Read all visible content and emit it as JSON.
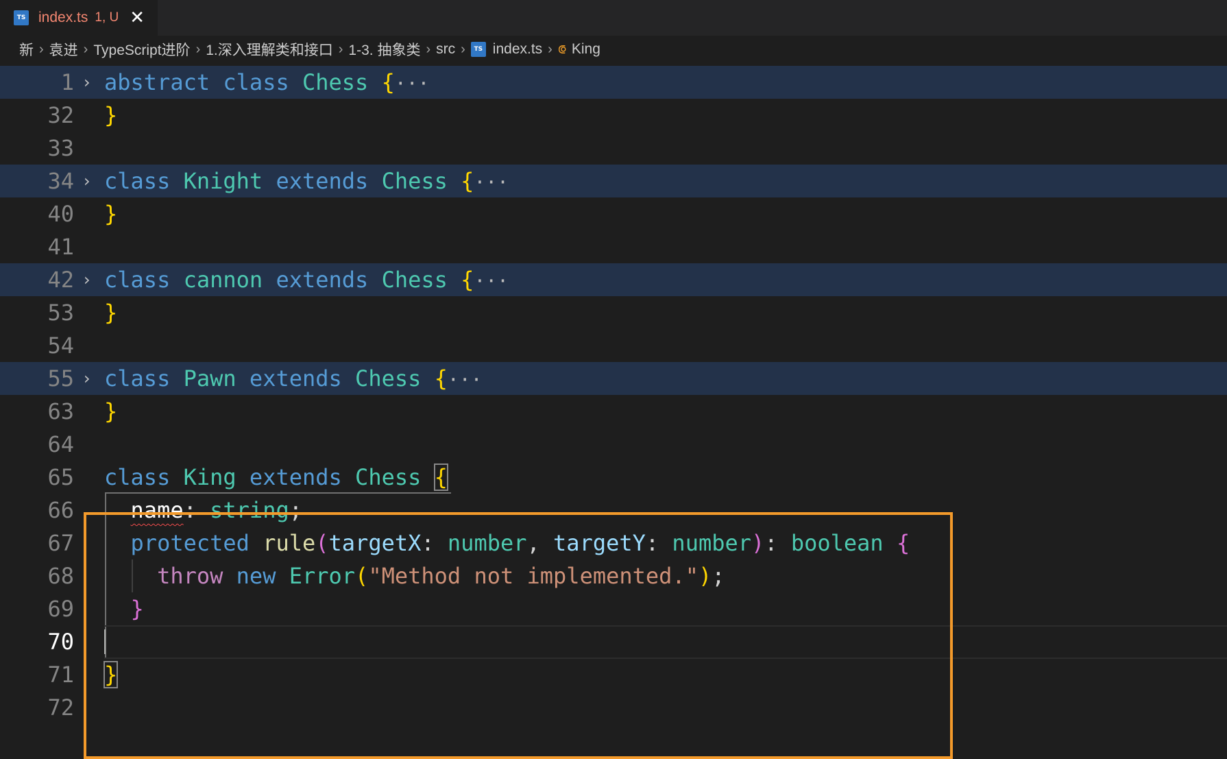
{
  "tab": {
    "icon": "TS",
    "title": "index.ts",
    "status": "1, U",
    "close": "✕"
  },
  "breadcrumb": {
    "items": [
      "新",
      "袁进",
      "TypeScript进阶",
      "1.深入理解类和接口",
      "1-3. 抽象类",
      "src"
    ],
    "file_icon": "TS",
    "file": "index.ts",
    "symbol": "King"
  },
  "editor": {
    "line_numbers": [
      "1",
      "32",
      "33",
      "34",
      "40",
      "41",
      "42",
      "53",
      "54",
      "55",
      "63",
      "64",
      "65",
      "66",
      "67",
      "68",
      "69",
      "70",
      "71",
      "72"
    ],
    "lines": {
      "l1": {
        "kw": "abstract",
        "kw_class": "class",
        "name": "Chess",
        "brace": "{",
        "dots": "···"
      },
      "l32": {
        "brace": "}"
      },
      "l34": {
        "kw": "class",
        "name": "Knight",
        "ext": "extends",
        "base": "Chess",
        "brace": "{",
        "dots": "···"
      },
      "l40": {
        "brace": "}"
      },
      "l42": {
        "kw": "class",
        "name": "cannon",
        "ext": "extends",
        "base": "Chess",
        "brace": "{",
        "dots": "···"
      },
      "l53": {
        "brace": "}"
      },
      "l55": {
        "kw": "class",
        "name": "Pawn",
        "ext": "extends",
        "base": "Chess",
        "brace": "{",
        "dots": "···"
      },
      "l63": {
        "brace": "}"
      },
      "l65": {
        "kw": "class",
        "name": "King",
        "ext": "extends",
        "base": "Chess",
        "brace": "{"
      },
      "l66": {
        "prop": "name",
        "colon": ": ",
        "type": "string",
        "semi": ";"
      },
      "l67": {
        "mod": "protected",
        "fn": "rule",
        "p1": "targetX",
        "t1": "number",
        "p2": "targetY",
        "t2": "number",
        "ret": "boolean"
      },
      "l68": {
        "throw": "throw",
        "new": "new",
        "err": "Error",
        "msg": "\"Method not implemented.\""
      },
      "l69": {
        "brace": "}"
      },
      "l71": {
        "brace": "}"
      }
    }
  },
  "colors": {
    "highlight_box": "#f39a2b",
    "folded_bg": "#23324a",
    "error_squiggle": "#f14c4c"
  }
}
